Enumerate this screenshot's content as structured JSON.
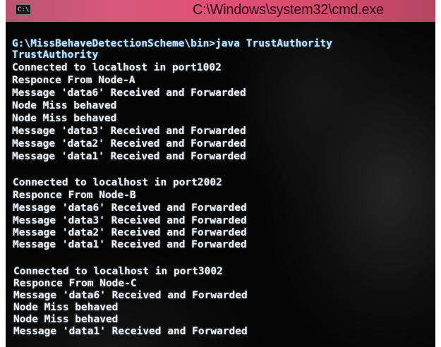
{
  "window": {
    "icon_text": "C:\\",
    "title": "C:\\Windows\\system32\\cmd.exe"
  },
  "console": {
    "lines": [
      "G:\\MissBehaveDetectionScheme\\bin>java TrustAuthority",
      "TrustAuthority",
      "Connected to localhost in port1002",
      "Responce From Node-A",
      "Message 'data6' Received and Forwarded",
      "Node Miss behaved",
      "Node Miss behaved",
      "Message 'data3' Received and Forwarded",
      "Message 'data2' Received and Forwarded",
      "Message 'data1' Received and Forwarded",
      "Connected to localhost in port2002",
      "Responce From Node-B",
      "Message 'data6' Received and Forwarded",
      "Message 'data3' Received and Forwarded",
      "Message 'data2' Received and Forwarded",
      "Message 'data1' Received and Forwarded",
      "Connected to localhost in port3002",
      "Responce From Node-C",
      "Message 'data6' Received and Forwarded",
      "Node Miss behaved",
      "Node Miss behaved",
      "Message 'data1' Received and Forwarded"
    ]
  }
}
